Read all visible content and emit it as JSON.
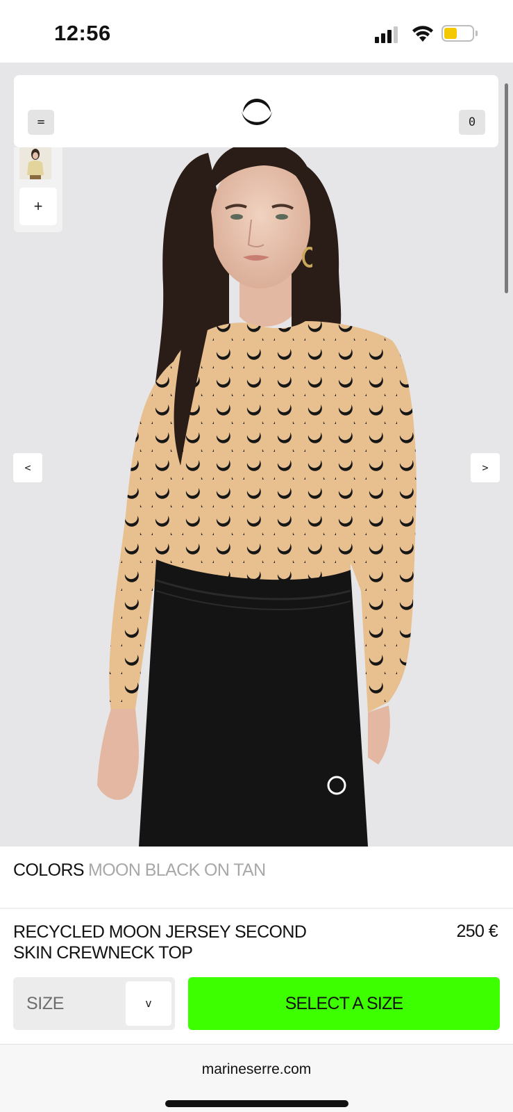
{
  "status_bar": {
    "time": "12:56",
    "battery_color": "#f5c900"
  },
  "header": {
    "menu_label": "=",
    "cart_count": "0",
    "logo_icon": "crescent-moon-logo"
  },
  "gallery": {
    "add_label": "+",
    "prev_label": "<",
    "next_label": ">",
    "shirt_color": "#e8bf8f",
    "pants_color": "#141414"
  },
  "product": {
    "colors_label": "COLORS",
    "color_value": "MOON BLACK ON TAN",
    "name": "RECYCLED MOON JERSEY SECOND SKIN CREWNECK TOP",
    "price": "250 €",
    "size_label": "SIZE",
    "size_chevron": "v",
    "cta_label": "SELECT A SIZE",
    "cta_color": "#3dff00"
  },
  "browser": {
    "url": "marineserre.com"
  }
}
